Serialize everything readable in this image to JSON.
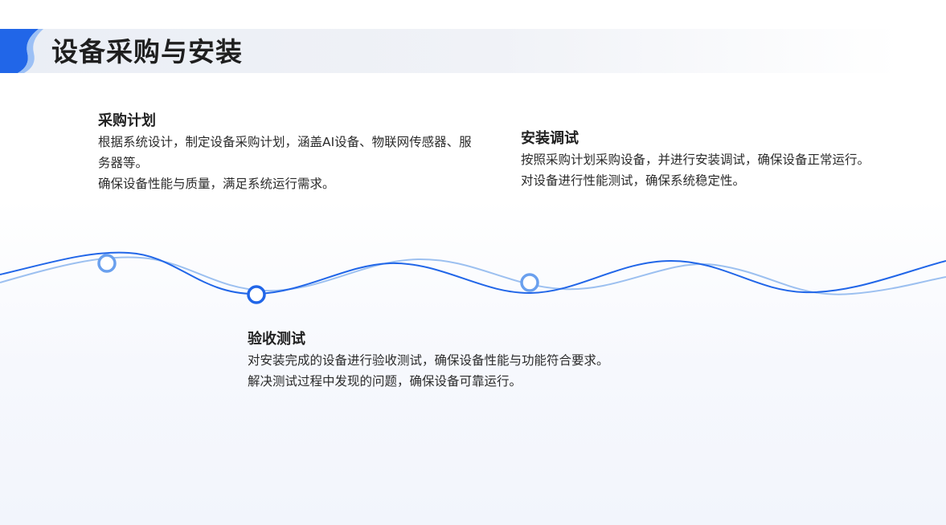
{
  "page": {
    "title": "设备采购与安装"
  },
  "steps": [
    {
      "title": "采购计划",
      "lines": [
        "根据系统设计，制定设备采购计划，涵盖AI设备、物联网传感器、服务器等。",
        "确保设备性能与质量，满足系统运行需求。"
      ]
    },
    {
      "title": "安装调试",
      "lines": [
        "按照采购计划采购设备，并进行安装调试，确保设备正常运行。",
        "对设备进行性能测试，确保系统稳定性。"
      ]
    },
    {
      "title": "验收测试",
      "lines": [
        "对安装完成的设备进行验收测试，确保设备性能与功能符合要求。",
        "解决测试过程中发现的问题，确保设备可靠运行。"
      ]
    }
  ],
  "colors": {
    "accent": "#2166e8",
    "accent_light": "#8cb4f0",
    "title_text": "#1f1f1f"
  }
}
